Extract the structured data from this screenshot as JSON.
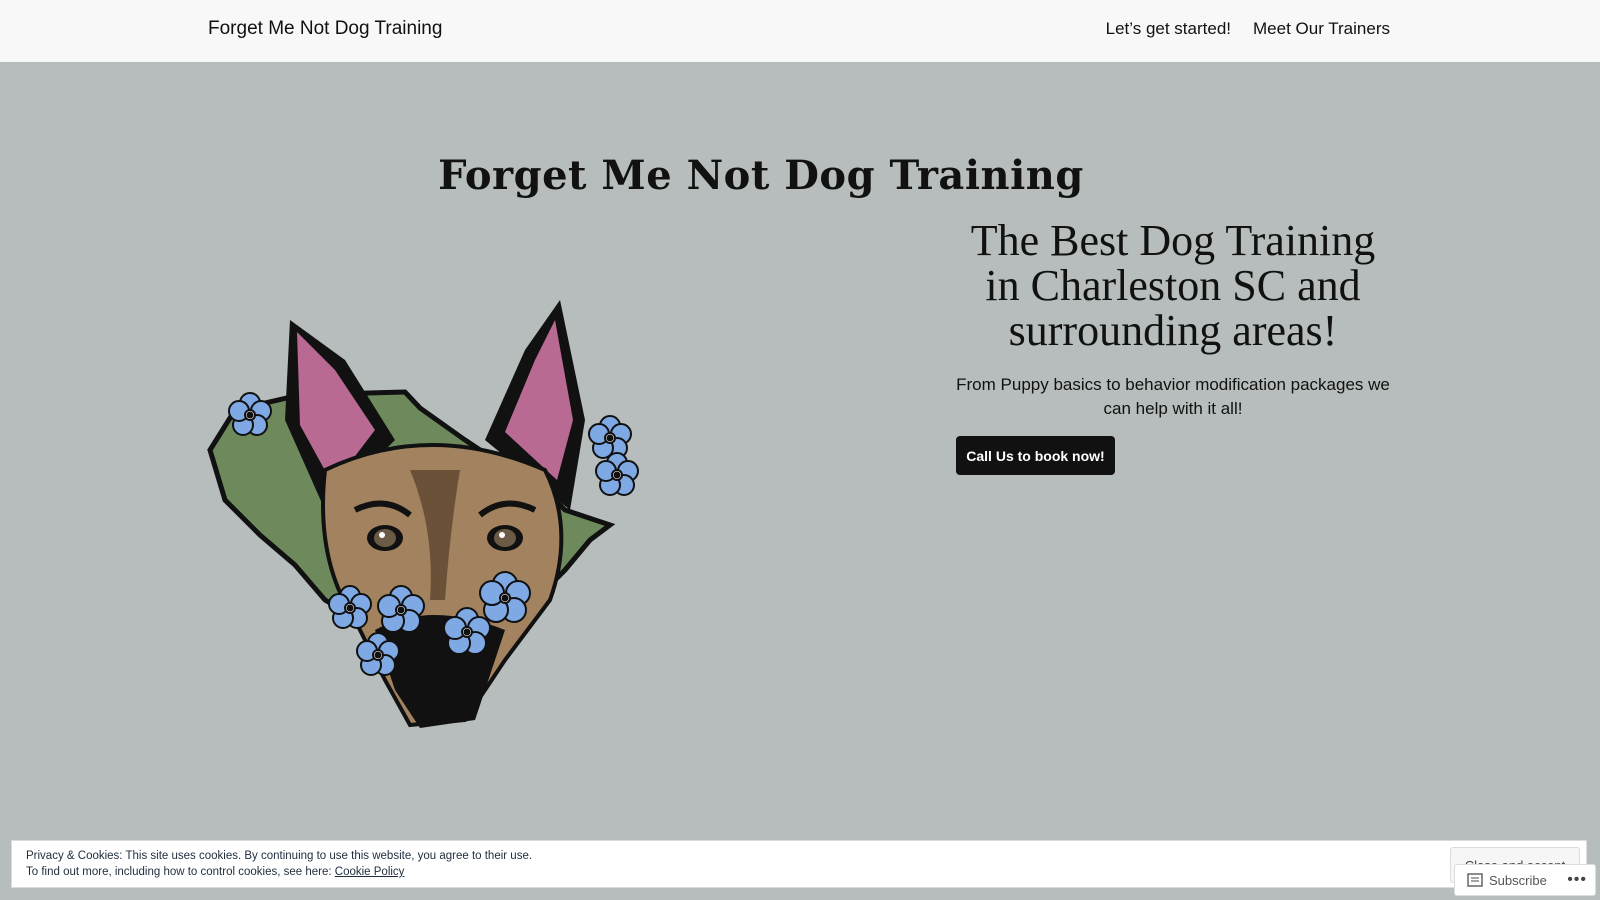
{
  "header": {
    "site_title": "Forget Me Not Dog Training",
    "nav": [
      "Let’s get started!",
      "Meet Our Trainers"
    ]
  },
  "hero": {
    "title": "Forget Me Not Dog Training",
    "headline": "The Best Dog Training in Charleston SC and surrounding areas!",
    "subtext": "From Puppy basics to behavior modification packages we can help with it all!",
    "cta_label": "Call Us to book now!",
    "illustration_icon": "dog-with-flowers-logo"
  },
  "cookie_banner": {
    "line1": "Privacy & Cookies: This site uses cookies. By continuing to use this website, you agree to their use.",
    "line2_prefix": "To find out more, including how to control cookies, see here: ",
    "link_label": "Cookie Policy",
    "button_label": "Close and accept"
  },
  "subscribe_bar": {
    "label": "Subscribe",
    "more": "•••"
  },
  "colors": {
    "background": "#b7bdbc",
    "topbar": "#f8f8f8",
    "cta_bg": "#111111",
    "state_green": "#6e8a5c",
    "dog_brown": "#a3835f",
    "ear_pink": "#b86a92",
    "flower_blue": "#7fa9e4"
  }
}
